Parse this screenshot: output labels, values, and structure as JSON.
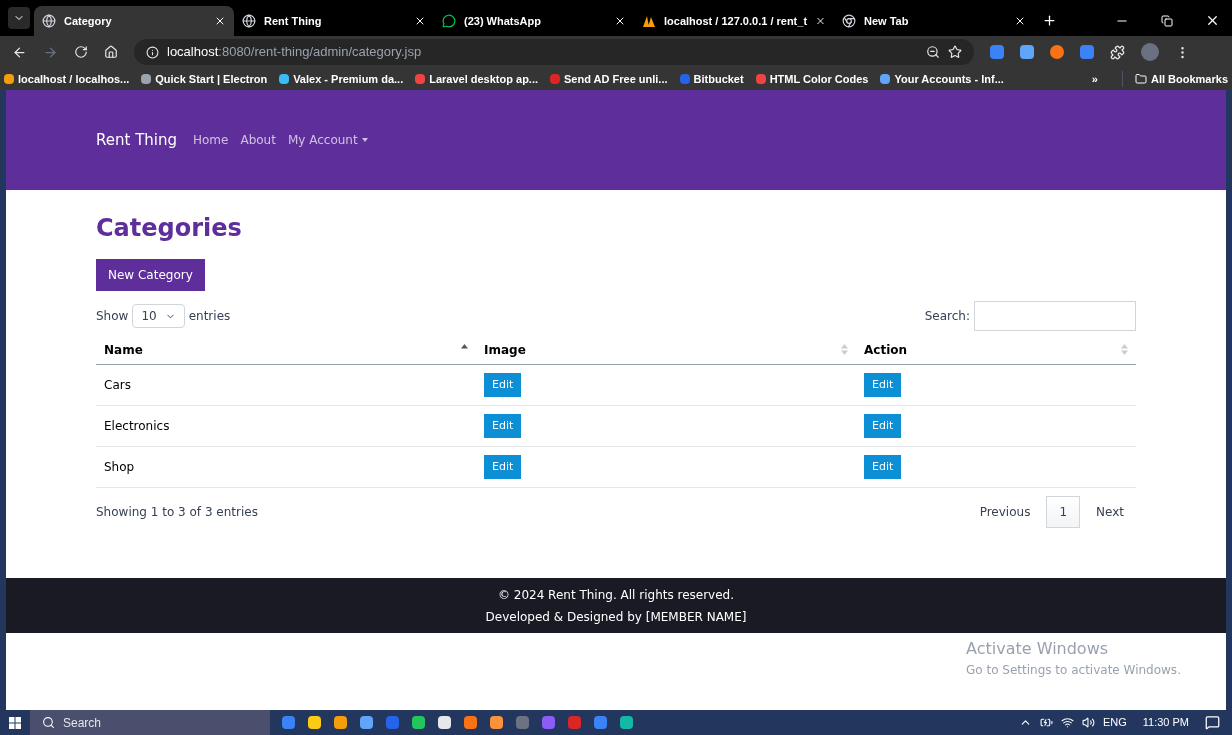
{
  "browser": {
    "tabs": [
      {
        "title": "Category",
        "selected": true,
        "kind": "globe"
      },
      {
        "title": "Rent Thing",
        "selected": false,
        "kind": "globe"
      },
      {
        "title": "(23) WhatsApp",
        "selected": false,
        "kind": "chat"
      },
      {
        "title": "localhost / 127.0.0.1 / rent_t",
        "selected": false,
        "kind": "sail"
      },
      {
        "title": "New Tab",
        "selected": false,
        "kind": "chrome"
      }
    ],
    "address": {
      "host": "localhost",
      "rest": ":8080/rent-thing/admin/category.jsp"
    },
    "bookmarks": [
      {
        "title": "localhost / localhos...",
        "color": "#f59e0b"
      },
      {
        "title": "Quick Start | Electron",
        "color": "#9ca3af"
      },
      {
        "title": "Valex - Premium da...",
        "color": "#38bdf8"
      },
      {
        "title": "Laravel desktop ap...",
        "color": "#ef4444"
      },
      {
        "title": "Send AD Free unli...",
        "color": "#dc2626"
      },
      {
        "title": "Bitbucket",
        "color": "#2563eb"
      },
      {
        "title": "HTML Color Codes",
        "color": "#ef4444"
      },
      {
        "title": "Your Accounts - Inf...",
        "color": "#60a5fa"
      }
    ],
    "more": "»",
    "all_bookmarks": "All Bookmarks"
  },
  "navbar": {
    "brand": "Rent Thing",
    "links": [
      {
        "label": "Home",
        "dropdown": false
      },
      {
        "label": "About",
        "dropdown": false
      },
      {
        "label": "My Account",
        "dropdown": true
      }
    ]
  },
  "page": {
    "title": "Categories",
    "new_button": "New Category",
    "length": {
      "before": "Show",
      "value": "10",
      "after": "entries"
    },
    "search_label": "Search:",
    "table": {
      "columns": [
        {
          "label": "Name",
          "sorted": true
        },
        {
          "label": "Image",
          "sorted": false
        },
        {
          "label": "Action",
          "sorted": false
        }
      ],
      "rows": [
        {
          "name": "Cars",
          "image_button": "Edit",
          "action_button": "Edit"
        },
        {
          "name": "Electronics",
          "image_button": "Edit",
          "action_button": "Edit"
        },
        {
          "name": "Shop",
          "image_button": "Edit",
          "action_button": "Edit"
        }
      ]
    },
    "info": "Showing 1 to 3 of 3 entries",
    "pagination": [
      {
        "label": "Previous",
        "kind": "prev",
        "selected": false
      },
      {
        "label": "1",
        "kind": "page",
        "selected": true
      },
      {
        "label": "Next",
        "kind": "next",
        "selected": false
      }
    ]
  },
  "footer": {
    "lines": [
      "© 2024 Rent Thing. All rights reserved.",
      "Developed & Designed by [MEMBER NAME]"
    ]
  },
  "activation": {
    "title": "Activate Windows",
    "subtitle": "Go to Settings to activate Windows."
  },
  "taskbar": {
    "search": "Search",
    "language": "ENG",
    "time": "11:30 PM"
  }
}
